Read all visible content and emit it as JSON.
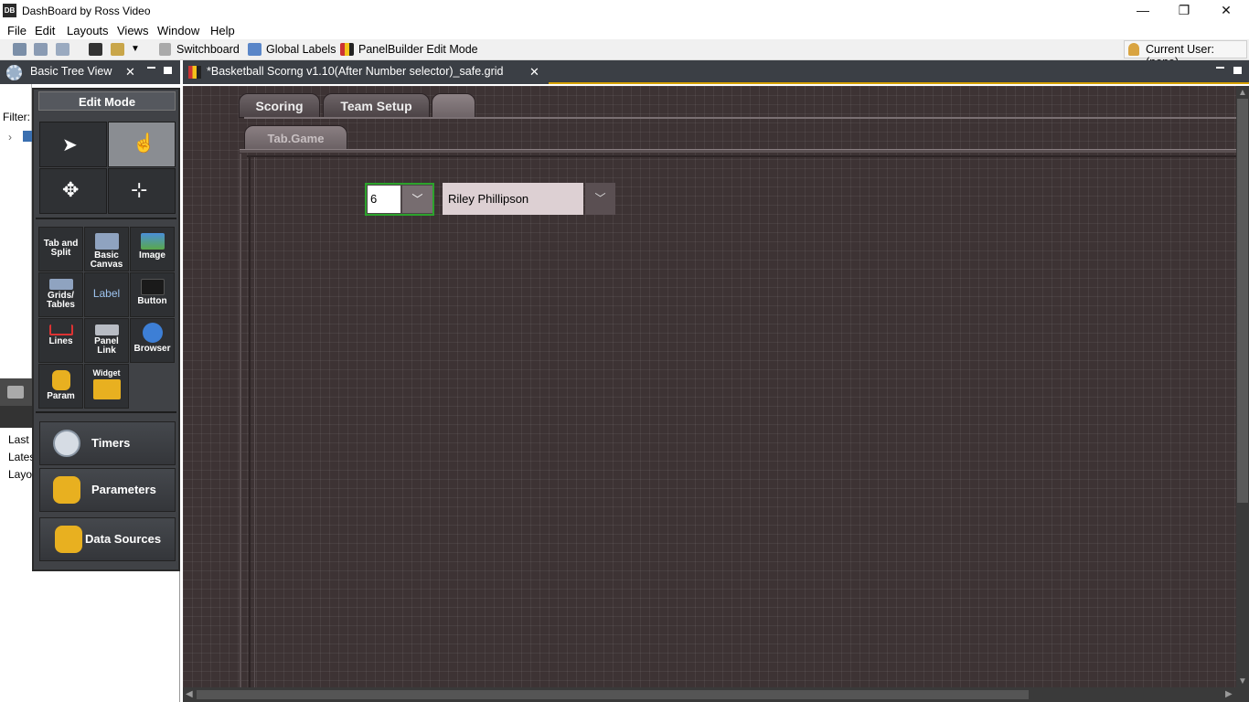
{
  "window": {
    "title": "DashBoard by Ross Video",
    "app_icon": "DB",
    "minimize": "—",
    "restore": "❐",
    "close": "✕"
  },
  "menu": [
    "File",
    "Edit",
    "Layouts",
    "Views",
    "Window",
    "Help"
  ],
  "toolbar": {
    "switchboard": "Switchboard",
    "global_labels": "Global Labels",
    "panelbuilder": "PanelBuilder Edit Mode",
    "current_user": "Current User: (none)"
  },
  "left_panel": {
    "title": "Basic Tree View",
    "filter_label": "Filter:",
    "bottom_texts": [
      "Last",
      "Lates",
      "Layo"
    ]
  },
  "palette": {
    "title": "Edit Mode",
    "tools": [
      {
        "label": "Tab and Split",
        "icon": "tab-split-icon"
      },
      {
        "label": "Basic Canvas",
        "icon": "canvas-icon"
      },
      {
        "label": "Image",
        "icon": "image-icon"
      },
      {
        "label": "Grids/ Tables",
        "icon": "grid-icon"
      },
      {
        "label": "Label",
        "icon": "label-icon"
      },
      {
        "label": "Button",
        "icon": "button-icon"
      },
      {
        "label": "Lines",
        "icon": "lines-icon"
      },
      {
        "label": "Panel Link",
        "icon": "panel-link-icon"
      },
      {
        "label": "Browser",
        "icon": "browser-icon"
      },
      {
        "label": "Param",
        "icon": "param-icon"
      },
      {
        "label": "Widget",
        "icon": "widget-icon"
      }
    ],
    "timers": "Timers",
    "parameters": "Parameters",
    "data_sources": "Data Sources"
  },
  "document": {
    "title": "*Basketball Scorng v1.10(After Number selector)_safe.grid",
    "tabs": [
      "Scoring",
      "Team Setup",
      ""
    ],
    "inner_tab": "Tab.Game",
    "number_combo": "6",
    "name_combo": "Riley Phillipson"
  },
  "colors": {
    "accent": "#d6a100",
    "canvas": "#3d3334",
    "selected_border": "#2ca32c"
  }
}
